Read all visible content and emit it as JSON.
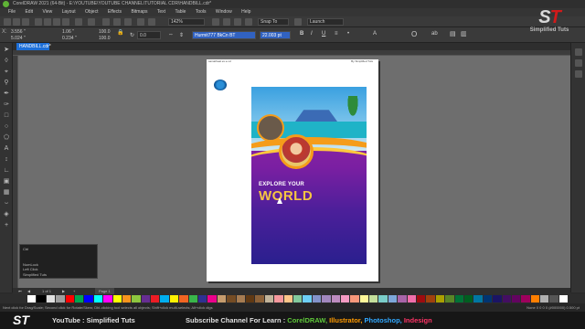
{
  "window": {
    "title": "CorelDRAW 2021 (64-Bit) - E:\\YOUTUBE\\YOUTUBE CHANNEL\\TUTORIAL CDR\\HANDBILL.cdr*"
  },
  "menu": [
    "File",
    "Edit",
    "View",
    "Layout",
    "Object",
    "Effects",
    "Bitmaps",
    "Text",
    "Table",
    "Tools",
    "Window",
    "Help"
  ],
  "toolbar": {
    "zoom": "142%",
    "snap": "Snap To",
    "launch": "Launch"
  },
  "properties": {
    "x": "3.556 \"",
    "y": "5.024 \"",
    "w": "1.06 \"",
    "h": "0.234 \"",
    "scale_w": "100.0",
    "scale_h": "100.0",
    "angle": "0.0",
    "font": "Hurmit777 BkCn BT",
    "size": "22.003 pt"
  },
  "document_tab": "HANDBILL.cdr*",
  "page": {
    "header_left": "samatheat.ex.e.xd",
    "header_right": "By Simplified Tuts"
  },
  "flyer": {
    "line1": "EXPLORE YOUR",
    "line2": "WORLD"
  },
  "hint": {
    "lines": [
      "Ctrl",
      "",
      "",
      "NumLock",
      "Left Click",
      "Simplified Tuts"
    ]
  },
  "page_nav": {
    "counter": "1 of 1",
    "page_label": "Page 1"
  },
  "status": {
    "text": "Next click for Drag/Scale; Second click for Rotate/Skew; Dbl-clicking tool selects all objects; Shift+click multi-selects; Alt+click digs",
    "right": "None    0 0 0 0 (#000000)   0.500 pt"
  },
  "palette": [
    "#ffffff",
    "#000000",
    "#e0e0e0",
    "#9e9e9e",
    "#ff0000",
    "#00a651",
    "#0000ff",
    "#00ffff",
    "#ff00ff",
    "#ffff00",
    "#f7941d",
    "#8dc63f",
    "#662d91",
    "#ed1c24",
    "#00aeef",
    "#fff200",
    "#f26522",
    "#39b54a",
    "#2e3192",
    "#ec008c",
    "#c69c6d",
    "#754c24",
    "#a67c52",
    "#603913",
    "#8c6239",
    "#c2b59b",
    "#f5989d",
    "#fdc689",
    "#82ca9c",
    "#6dcff6",
    "#8393ca",
    "#a187be",
    "#bd8cbf",
    "#f49ac2",
    "#f7977a",
    "#fff799",
    "#c4df9b",
    "#7accc8",
    "#7da7d9",
    "#a864a8",
    "#f06eaa",
    "#9e0b0f",
    "#a0410d",
    "#aba000",
    "#598527",
    "#007236",
    "#005e20",
    "#0076a3",
    "#003471",
    "#1b1464",
    "#440e62",
    "#630460",
    "#9e005d",
    "#ff7f00",
    "#b0b0b0",
    "#555555",
    "#ffffff"
  ],
  "footer": {
    "logo": "ST",
    "youtube": "YouTube : Simplified Tuts",
    "subscribe_prefix": "Subscribe Channel For Learn :",
    "apps": [
      {
        "name": "CorelDRAW,",
        "color": "#5fc83a"
      },
      {
        "name": "Illustrator,",
        "color": "#ff9a00"
      },
      {
        "name": "Photoshop,",
        "color": "#31a8ff"
      },
      {
        "name": "Indesign",
        "color": "#ff3366"
      }
    ]
  },
  "brand": {
    "mark_s": "S",
    "mark_t": "T",
    "name": "Simplified Tuts"
  }
}
